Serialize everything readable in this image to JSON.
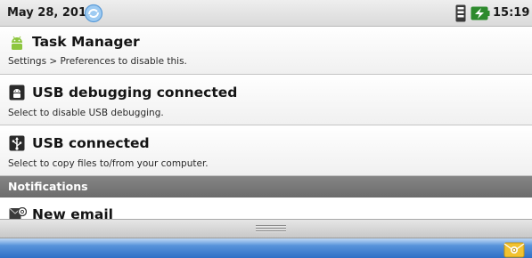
{
  "status_bar": {
    "date": "May 28, 2011",
    "time": "15:19",
    "icons": [
      "sync-icon",
      "signal-icon",
      "battery-icon"
    ]
  },
  "ongoing": [
    {
      "title": "Task Manager",
      "subtitle": "Settings > Preferences to disable this.",
      "icon": "android-icon"
    },
    {
      "title": "USB debugging connected",
      "subtitle": "Select to disable USB debugging.",
      "icon": "usb-debugging-icon"
    },
    {
      "title": "USB connected",
      "subtitle": "Select to copy files to/from your computer.",
      "icon": "usb-icon"
    }
  ],
  "notifications": {
    "header": "Notifications",
    "items": [
      {
        "title": "New email",
        "icon": "email-icon"
      }
    ]
  },
  "colors": {
    "accent_green": "#8dc63f",
    "section_header": "#777777",
    "bottom_strip": "#3b7fd4"
  }
}
